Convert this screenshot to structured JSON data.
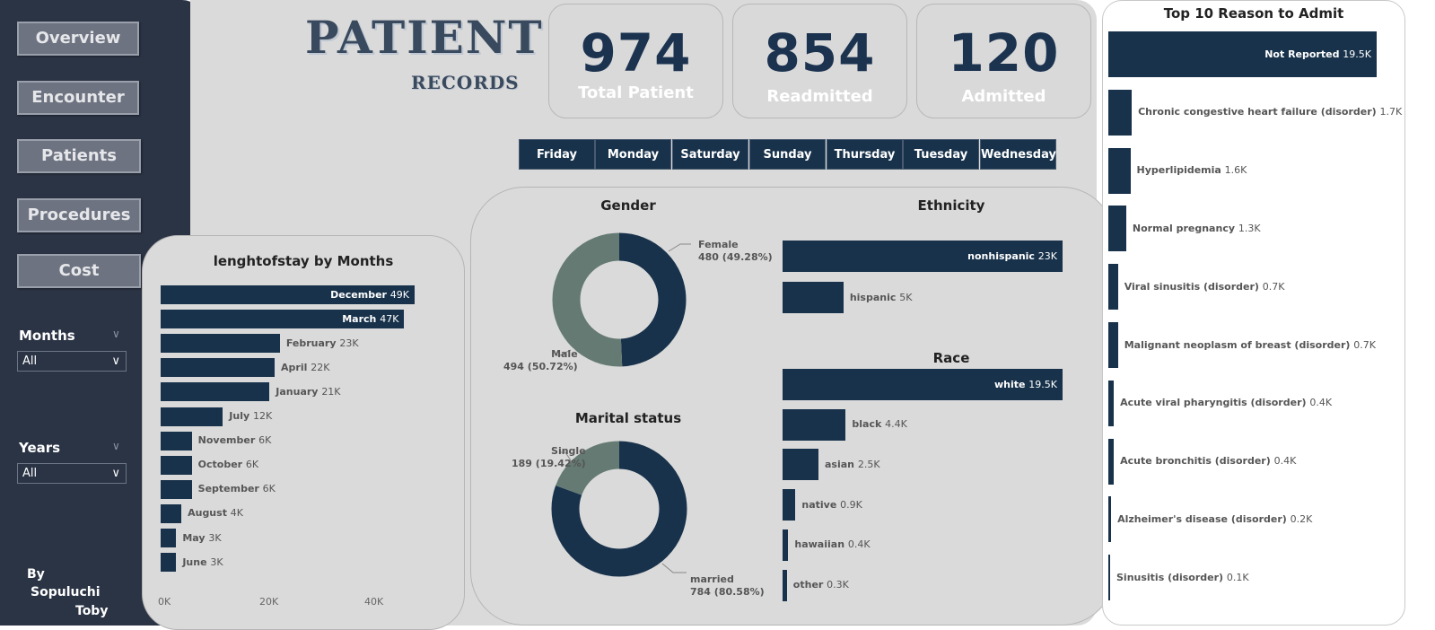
{
  "sidebar": {
    "nav": [
      "Overview",
      "Encounter",
      "Patients",
      "Procedures",
      "Cost"
    ],
    "months_label": "Months",
    "months_value": "All",
    "years_label": "Years",
    "years_value": "All",
    "author": [
      "By",
      "Sopuluchi",
      "Toby"
    ]
  },
  "header": {
    "title": "PATIENT",
    "subtitle": "RECORDS"
  },
  "kpis": [
    {
      "value": "974",
      "label": "Total Patient"
    },
    {
      "value": "854",
      "label": "Readmitted"
    },
    {
      "value": "120",
      "label": "Admitted"
    }
  ],
  "days": [
    "Friday",
    "Monday",
    "Saturday",
    "Sunday",
    "Thursday",
    "Tuesday",
    "Wednesday"
  ],
  "colors": {
    "navy": "#18324b",
    "gray_green": "#647a72",
    "panel": "#dadada"
  },
  "chart_data": [
    {
      "id": "los",
      "type": "bar",
      "orientation": "horizontal",
      "title": "lenghtofstay by Months",
      "categories": [
        "December",
        "March",
        "February",
        "April",
        "January",
        "July",
        "November",
        "October",
        "September",
        "August",
        "May",
        "June"
      ],
      "values": [
        49,
        47,
        23,
        22,
        21,
        12,
        6,
        6,
        6,
        4,
        3,
        3
      ],
      "value_labels": [
        "49K",
        "47K",
        "23K",
        "22K",
        "21K",
        "12K",
        "6K",
        "6K",
        "6K",
        "4K",
        "3K",
        "3K"
      ],
      "x_ticks": [
        "0K",
        "20K",
        "40K"
      ],
      "xlim": [
        0,
        49
      ]
    },
    {
      "id": "gender",
      "type": "pie",
      "title": "Gender",
      "labels": [
        "Female",
        "Male"
      ],
      "values": [
        480,
        494
      ],
      "display": [
        "480 (49.28%)",
        "494 (50.72%)"
      ],
      "colors": [
        "#18324b",
        "#647a72"
      ]
    },
    {
      "id": "marital",
      "type": "pie",
      "title": "Marital status",
      "labels": [
        "married",
        "Single"
      ],
      "values": [
        784,
        189
      ],
      "display": [
        "784 (80.58%)",
        "189 (19.42%)"
      ],
      "colors": [
        "#18324b",
        "#647a72"
      ]
    },
    {
      "id": "ethnicity",
      "type": "bar",
      "orientation": "horizontal",
      "title": "Ethnicity",
      "categories": [
        "nonhispanic",
        "hispanic"
      ],
      "values": [
        23,
        5
      ],
      "value_labels": [
        "23K",
        "5K"
      ],
      "xlim": [
        0,
        23
      ]
    },
    {
      "id": "race",
      "type": "bar",
      "orientation": "horizontal",
      "title": "Race",
      "categories": [
        "white",
        "black",
        "asian",
        "native",
        "hawaiian",
        "other"
      ],
      "values": [
        19.5,
        4.4,
        2.5,
        0.9,
        0.4,
        0.3
      ],
      "value_labels": [
        "19.5K",
        "4.4K",
        "2.5K",
        "0.9K",
        "0.4K",
        "0.3K"
      ],
      "xlim": [
        0,
        19.5
      ]
    },
    {
      "id": "reasons",
      "type": "bar",
      "orientation": "horizontal",
      "title": "Top 10 Reason to Admit",
      "categories": [
        "Not Reported",
        "Chronic congestive heart failure (disorder)",
        "Hyperlipidemia",
        "Normal pregnancy",
        "Viral sinusitis (disorder)",
        "Malignant neoplasm of breast (disorder)",
        "Acute viral pharyngitis (disorder)",
        "Acute bronchitis (disorder)",
        "Alzheimer's disease (disorder)",
        "Sinusitis (disorder)"
      ],
      "values": [
        19.5,
        1.7,
        1.6,
        1.3,
        0.7,
        0.7,
        0.4,
        0.4,
        0.2,
        0.1
      ],
      "value_labels": [
        "19.5K",
        "1.7K",
        "1.6K",
        "1.3K",
        "0.7K",
        "0.7K",
        "0.4K",
        "0.4K",
        "0.2K",
        "0.1K"
      ],
      "xlim": [
        0,
        19.5
      ]
    }
  ]
}
